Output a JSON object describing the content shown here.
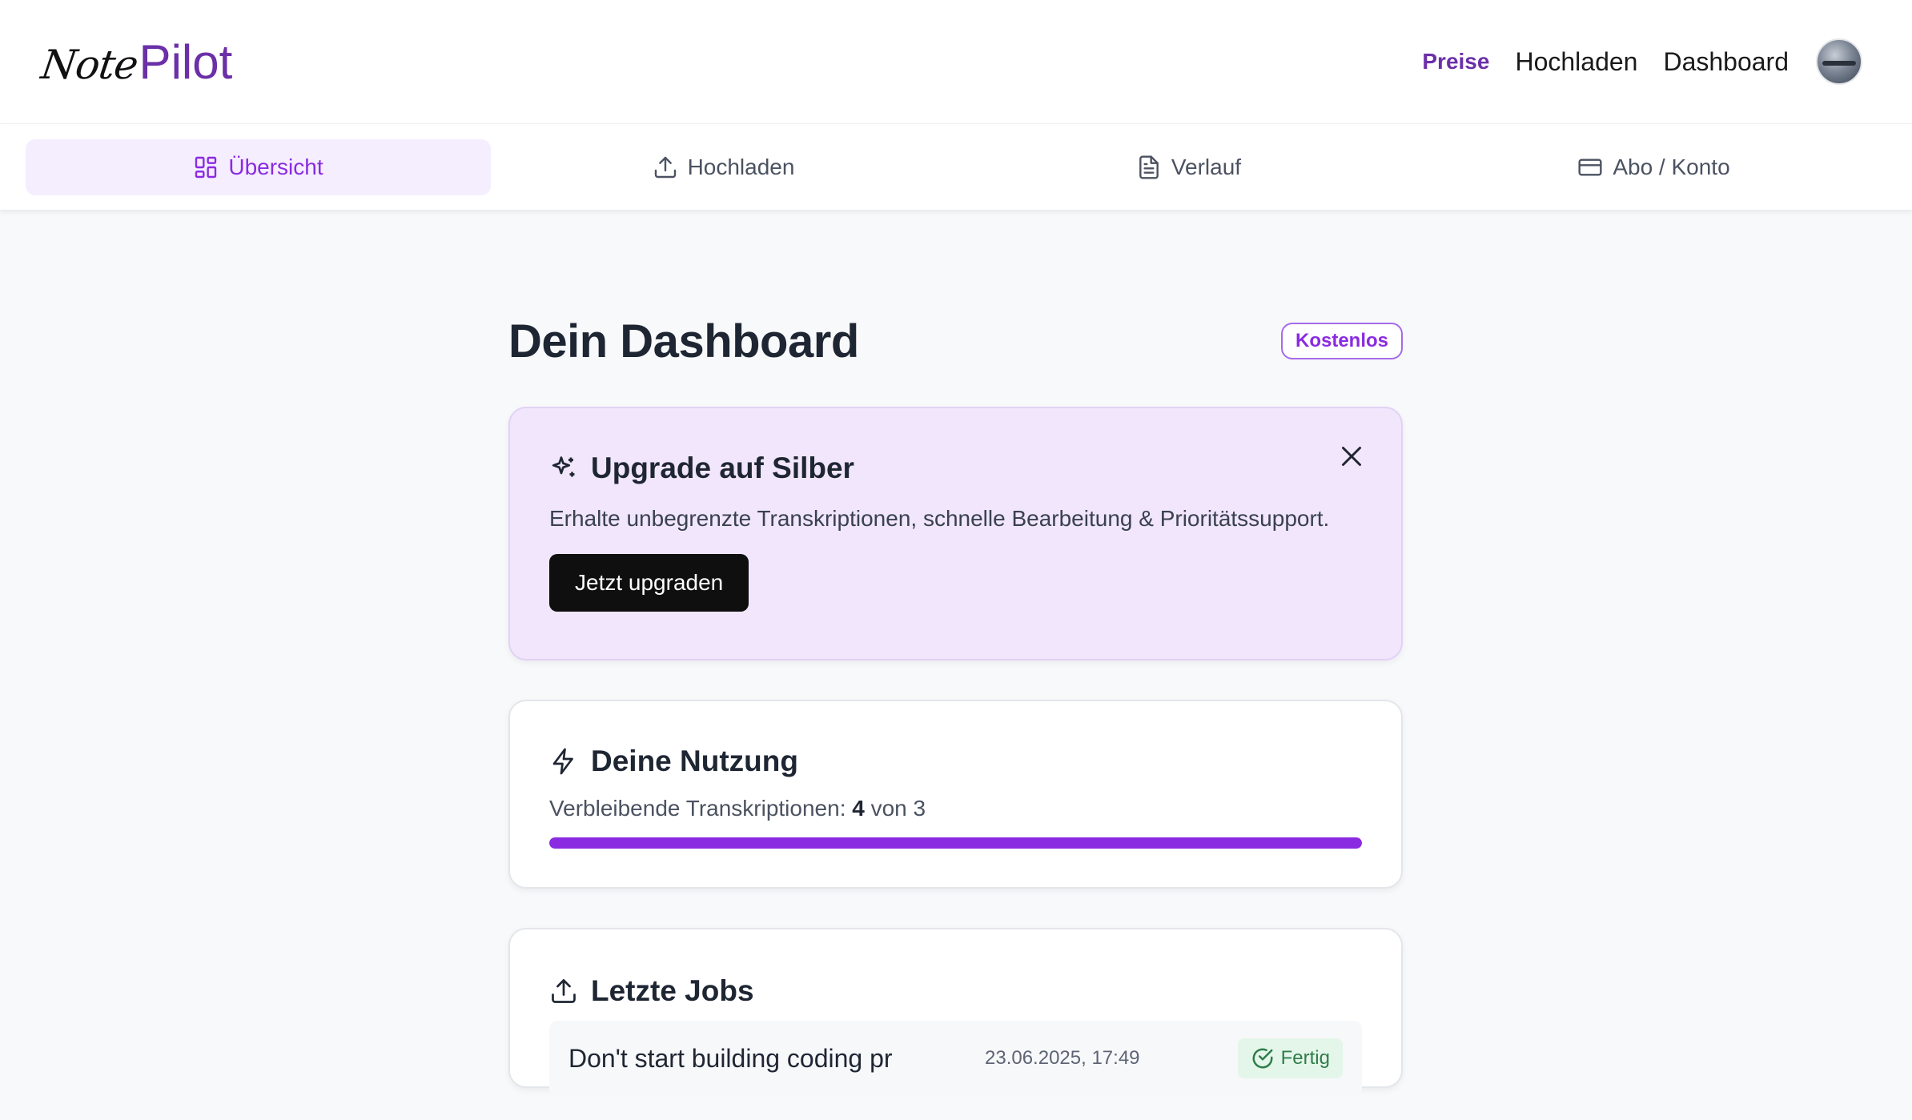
{
  "brand": {
    "note": "Note",
    "pilot": "Pilot"
  },
  "topnav": {
    "items": [
      {
        "label": "Preise"
      },
      {
        "label": "Hochladen"
      },
      {
        "label": "Dashboard"
      }
    ]
  },
  "tabs": [
    {
      "label": "Übersicht",
      "icon": "grid-icon"
    },
    {
      "label": "Hochladen",
      "icon": "upload-icon"
    },
    {
      "label": "Verlauf",
      "icon": "document-icon"
    },
    {
      "label": "Abo / Konto",
      "icon": "credit-card-icon"
    }
  ],
  "page": {
    "title": "Dein Dashboard",
    "plan_badge": "Kostenlos"
  },
  "upgrade": {
    "title": "Upgrade auf Silber",
    "description": "Erhalte unbegrenzte Transkriptionen, schnelle Bearbeitung & Prioritätssupport.",
    "cta": "Jetzt upgraden"
  },
  "usage": {
    "title": "Deine Nutzung",
    "label": "Verbleibende Transkriptionen:",
    "remaining": "4",
    "separator": "von",
    "total": "3",
    "progress_percent": 100
  },
  "jobs": {
    "title": "Letzte Jobs",
    "items": [
      {
        "name": "Don't start building coding pr",
        "date": "23.06.2025, 17:49",
        "status": "Fertig"
      }
    ]
  },
  "colors": {
    "accent": "#8a2be2",
    "brand": "#6b2fa8",
    "success": "#2f7d4a"
  }
}
